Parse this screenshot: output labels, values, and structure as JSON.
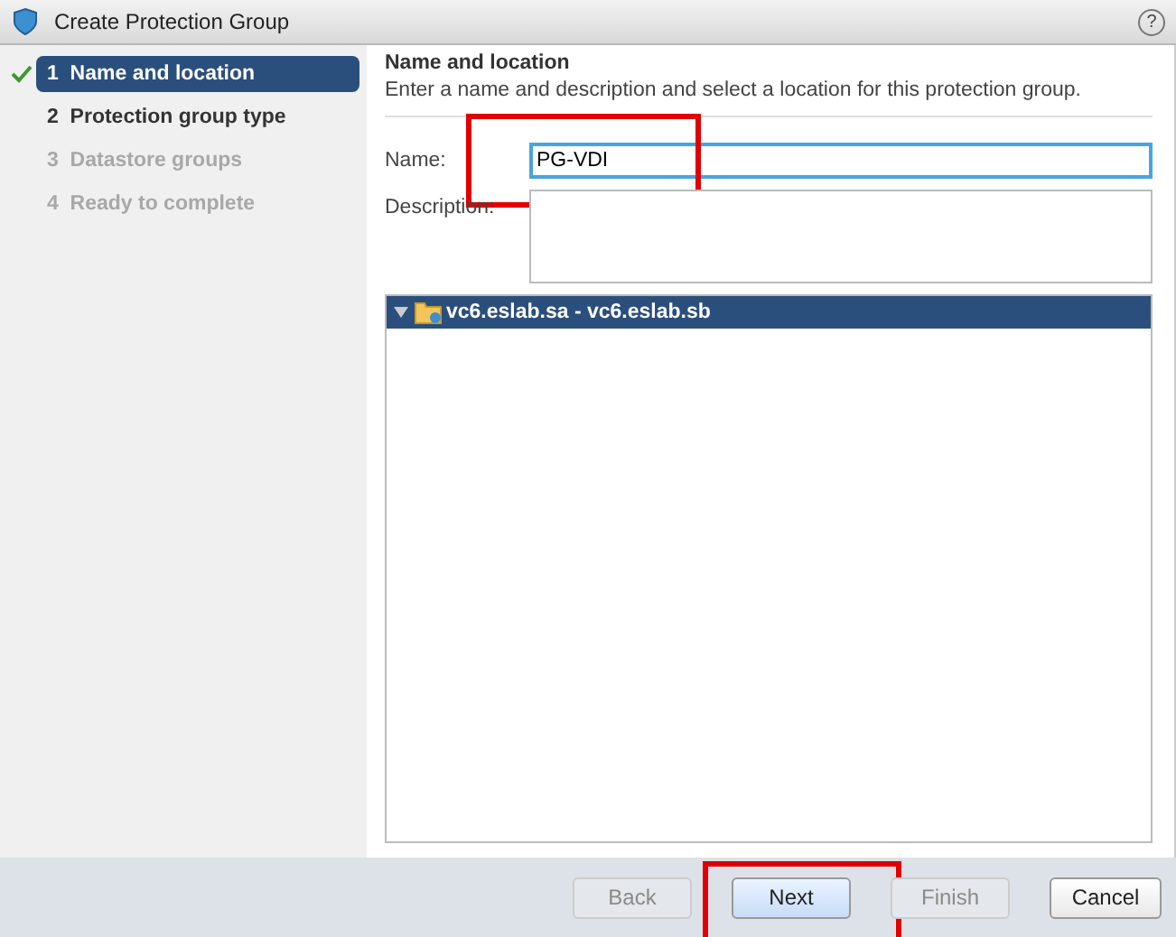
{
  "window": {
    "title": "Create Protection Group",
    "help": "?"
  },
  "steps": [
    {
      "number": "1",
      "label": "Name and location",
      "selected": true,
      "completed": true,
      "disabled": false
    },
    {
      "number": "2",
      "label": "Protection group type",
      "selected": false,
      "completed": false,
      "disabled": false
    },
    {
      "number": "3",
      "label": "Datastore groups",
      "selected": false,
      "completed": false,
      "disabled": true
    },
    {
      "number": "4",
      "label": "Ready to complete",
      "selected": false,
      "completed": false,
      "disabled": true
    }
  ],
  "page": {
    "heading": "Name and location",
    "description": "Enter a name and description and select a location for this protection group."
  },
  "form": {
    "name_label": "Name:",
    "name_value": "PG-VDI",
    "name_highlighted": true,
    "description_label": "Description:"
  },
  "tree": [
    {
      "label": "vc6.eslab.sa - vc6.eslab.sb",
      "expanded": true,
      "selected": true
    }
  ],
  "buttons": [
    {
      "label": "Back",
      "disabled": true,
      "primary": false,
      "highlighted": false
    },
    {
      "label": "Next",
      "disabled": false,
      "primary": true,
      "highlighted": true
    },
    {
      "label": "Finish",
      "disabled": true,
      "primary": false,
      "highlighted": false
    },
    {
      "label": "Cancel",
      "disabled": false,
      "primary": false,
      "highlighted": false
    }
  ]
}
